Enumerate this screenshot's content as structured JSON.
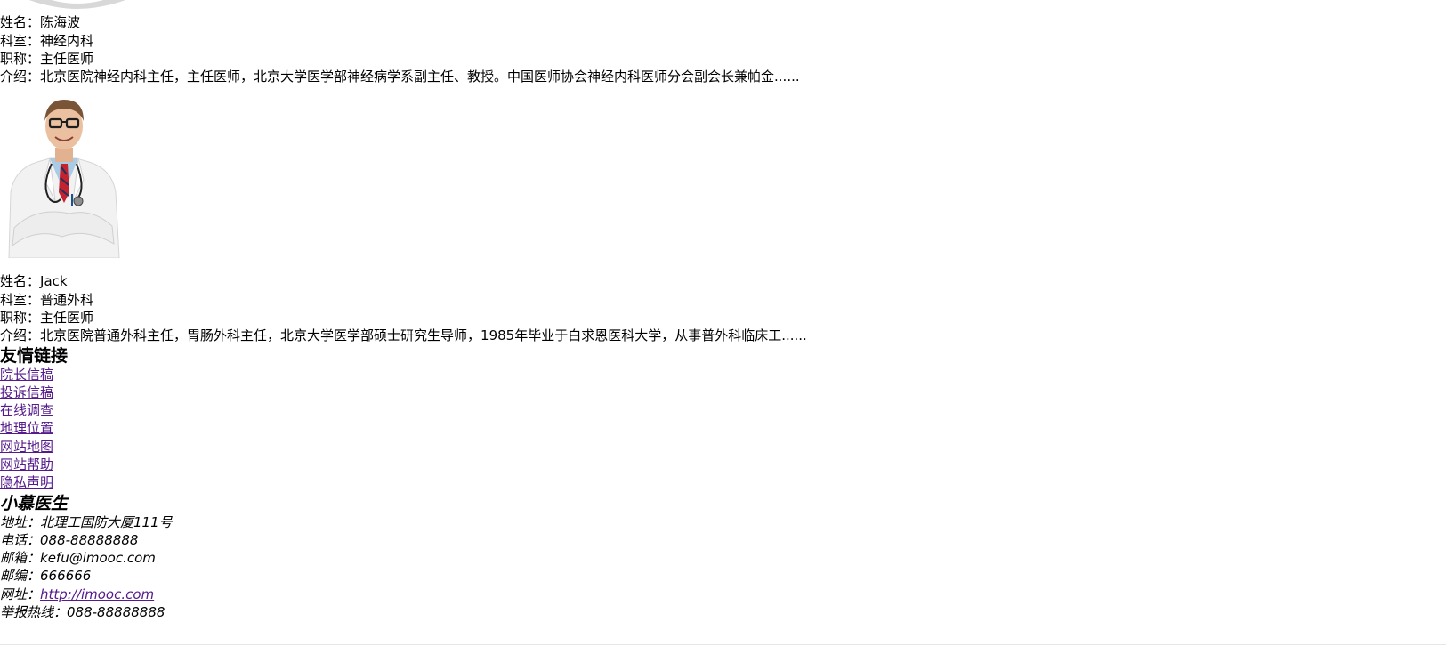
{
  "doctors": [
    {
      "name_label": "姓名：",
      "name": "陈海波",
      "dept_label": "科室：",
      "dept": "神经内科",
      "title_label": "职称：",
      "title": "主任医师",
      "intro_label": "介绍：",
      "intro": "北京医院神经内科主任，主任医师，北京大学医学部神经病学系副主任、教授。中国医师协会神经内科医师分会副会长兼帕金......"
    },
    {
      "name_label": "姓名：",
      "name": "Jack",
      "dept_label": "科室：",
      "dept": "普通外科",
      "title_label": "职称：",
      "title": "主任医师",
      "intro_label": "介绍：",
      "intro": "北京医院普通外科主任，胃肠外科主任，北京大学医学部硕士研究生导师，1985年毕业于白求恩医科大学，从事普外科临床工......"
    }
  ],
  "links": {
    "heading": "友情链接",
    "items": [
      "院长信稿",
      "投诉信稿",
      "在线调查",
      "地理位置",
      "网站地图",
      "网站帮助",
      "隐私声明"
    ]
  },
  "footer": {
    "brand": "小慕医生",
    "address_label": "地址：",
    "address": "北理工国防大厦111号",
    "phone_label": "电话：",
    "phone": "088-88888888",
    "email_label": "邮箱：",
    "email": "kefu@imooc.com",
    "zip_label": "邮编：",
    "zip": "666666",
    "website_label": "网址：",
    "website": "http://imooc.com",
    "hotline_label": "举报热线：",
    "hotline": "088-88888888"
  }
}
